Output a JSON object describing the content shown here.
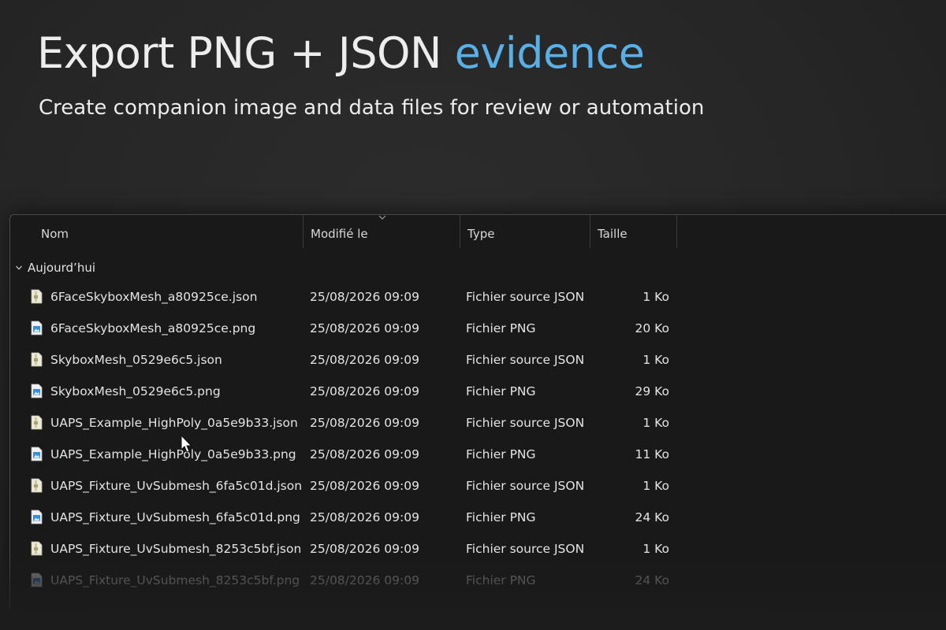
{
  "slide": {
    "title_main": "Export PNG + JSON",
    "title_accent": "evidence",
    "subtitle": "Create companion image and data files for review or automation"
  },
  "colors": {
    "accent": "#5aafe6",
    "background": "#262626",
    "explorer_bg": "#191919"
  },
  "columns": {
    "name": "Nom",
    "modified": "Modifié le",
    "type": "Type",
    "size": "Taille"
  },
  "group": {
    "label": "Aujourd’hui",
    "icon": "chevron-down-icon"
  },
  "files": [
    {
      "name": "6FaceSkyboxMesh_a80925ce.json",
      "modified": "25/08/2026 09:09",
      "type": "Fichier source JSON",
      "size": "1 Ko",
      "icon": "json-file-icon"
    },
    {
      "name": "6FaceSkyboxMesh_a80925ce.png",
      "modified": "25/08/2026 09:09",
      "type": "Fichier PNG",
      "size": "20 Ko",
      "icon": "png-file-icon"
    },
    {
      "name": "SkyboxMesh_0529e6c5.json",
      "modified": "25/08/2026 09:09",
      "type": "Fichier source JSON",
      "size": "1 Ko",
      "icon": "json-file-icon"
    },
    {
      "name": "SkyboxMesh_0529e6c5.png",
      "modified": "25/08/2026 09:09",
      "type": "Fichier PNG",
      "size": "29 Ko",
      "icon": "png-file-icon"
    },
    {
      "name": "UAPS_Example_HighPoly_0a5e9b33.json",
      "modified": "25/08/2026 09:09",
      "type": "Fichier source JSON",
      "size": "1 Ko",
      "icon": "json-file-icon"
    },
    {
      "name": "UAPS_Example_HighPoly_0a5e9b33.png",
      "modified": "25/08/2026 09:09",
      "type": "Fichier PNG",
      "size": "11 Ko",
      "icon": "png-file-icon"
    },
    {
      "name": "UAPS_Fixture_UvSubmesh_6fa5c01d.json",
      "modified": "25/08/2026 09:09",
      "type": "Fichier source JSON",
      "size": "1 Ko",
      "icon": "json-file-icon"
    },
    {
      "name": "UAPS_Fixture_UvSubmesh_6fa5c01d.png",
      "modified": "25/08/2026 09:09",
      "type": "Fichier PNG",
      "size": "24 Ko",
      "icon": "png-file-icon"
    },
    {
      "name": "UAPS_Fixture_UvSubmesh_8253c5bf.json",
      "modified": "25/08/2026 09:09",
      "type": "Fichier source JSON",
      "size": "1 Ko",
      "icon": "json-file-icon"
    },
    {
      "name": "UAPS_Fixture_UvSubmesh_8253c5bf.png",
      "modified": "25/08/2026 09:09",
      "type": "Fichier PNG",
      "size": "24 Ko",
      "icon": "png-file-icon"
    }
  ]
}
